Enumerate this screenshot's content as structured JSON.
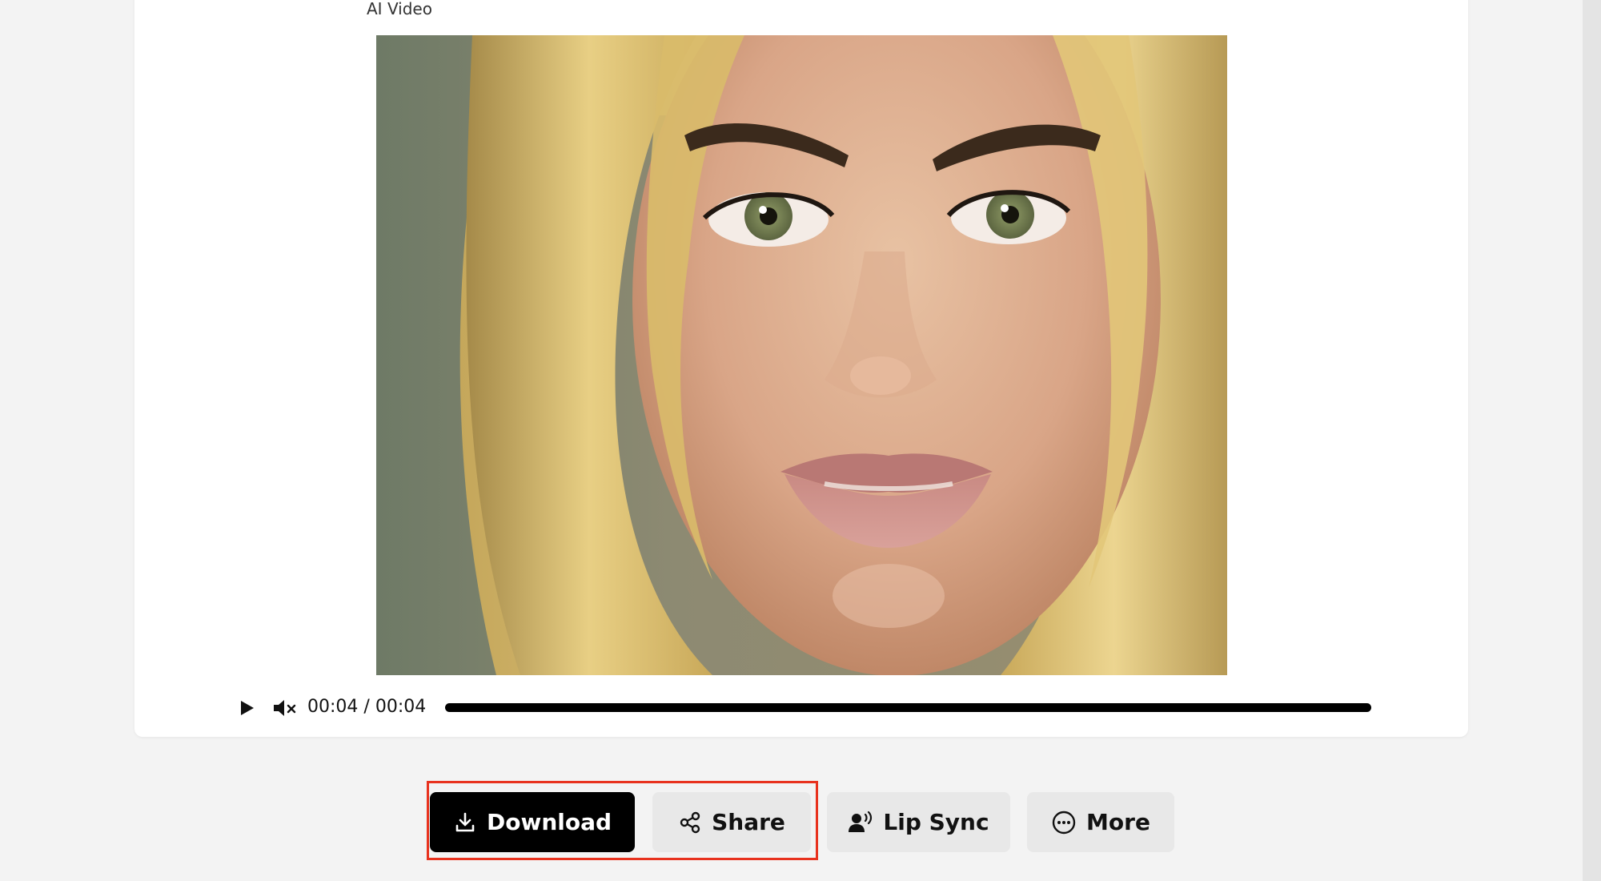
{
  "card": {
    "title": "AI Video"
  },
  "video": {
    "subject": "portrait of a smiling woman with long wavy blonde hair",
    "current_time": "00:04",
    "separator": "/",
    "duration": "00:04",
    "progress_fraction": 1.0,
    "muted": true
  },
  "controls": {
    "play_icon": "play-icon",
    "mute_icon": "volume-muted-icon"
  },
  "actions": [
    {
      "id": "download",
      "label": "Download",
      "icon": "download-icon",
      "style": "primary"
    },
    {
      "id": "share",
      "label": "Share",
      "icon": "share-icon",
      "style": "secondary"
    },
    {
      "id": "lipsync",
      "label": "Lip Sync",
      "icon": "lip-sync-icon",
      "style": "secondary"
    },
    {
      "id": "more",
      "label": "More",
      "icon": "more-icon",
      "style": "secondary"
    }
  ],
  "colors": {
    "primary_button": "#000000",
    "secondary_button": "#e8e8e8",
    "highlight_border": "#e8321e",
    "page_background": "#f3f3f3"
  }
}
